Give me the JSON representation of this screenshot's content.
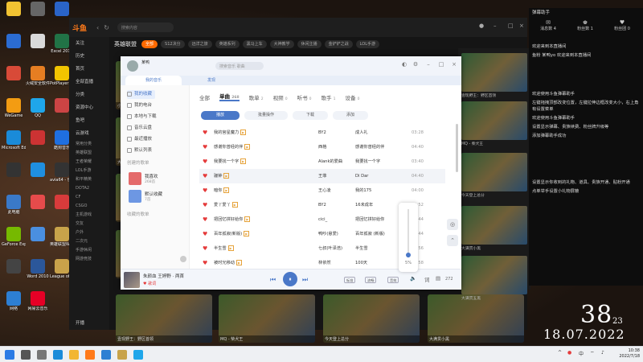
{
  "desktop": {
    "icons": [
      {
        "label": "",
        "color": "#f1c232"
      },
      {
        "label": "",
        "color": "#2b6cd2"
      },
      {
        "label": "",
        "color": "#d84a38"
      },
      {
        "label": "WeGame",
        "color": "#f39c12"
      },
      {
        "label": "Microsoft Edge",
        "color": "#1a8bd9"
      },
      {
        "label": "",
        "color": "#333333"
      },
      {
        "label": "此电脑",
        "color": "#3a79c8"
      },
      {
        "label": "GeForce Experience",
        "color": "#76b900"
      },
      {
        "label": "",
        "color": "#444444"
      },
      {
        "label": "网络",
        "color": "#2d7fd3"
      },
      {
        "label": "",
        "color": "#666666"
      },
      {
        "label": "",
        "color": "#d9d9d9"
      },
      {
        "label": "火绒安全软件",
        "color": "#e67e22"
      },
      {
        "label": "QQ",
        "color": "#1fa6ea"
      },
      {
        "label": "",
        "color": "#cc3333"
      },
      {
        "label": "",
        "color": "#1f8fe0"
      },
      {
        "label": "",
        "color": "#e64b4b"
      },
      {
        "label": "",
        "color": "#4a8fe0"
      },
      {
        "label": "Word 2010",
        "color": "#2b579a"
      },
      {
        "label": "网易云音乐",
        "color": "#e60026"
      },
      {
        "label": "",
        "color": "#2a64c8"
      },
      {
        "label": "Excel 2010",
        "color": "#217346"
      },
      {
        "label": "PotPlayer 64 bit",
        "color": "#f2c400"
      },
      {
        "label": "",
        "color": "#cc4444"
      },
      {
        "label": "酷狗音乐",
        "color": "#1f6fe0"
      },
      {
        "label": "avia64 - 快捷方式",
        "color": "#333333"
      },
      {
        "label": "",
        "color": "#d83b3b"
      },
      {
        "label": "英雄联盟WeGame版",
        "color": "#c8a34a"
      },
      {
        "label": "League of Legends",
        "color": "#c9a24a"
      }
    ]
  },
  "douyu": {
    "logo": "斗鱼",
    "search_placeholder": "搜索内容",
    "section_title": "英雄联盟",
    "categories": [
      "全部",
      "S12决分",
      "远洋之旅",
      "英雄系列",
      "黑马上车",
      "大神教学",
      "休闲主播",
      "金铲铲之战",
      "LOL手游"
    ],
    "sidebar": [
      "关注",
      "历史",
      "首页",
      "全部直播",
      "分类",
      "资源中心",
      "鱼吧",
      "云游戏",
      "常用分类",
      "英雄联盟",
      "王者荣耀",
      "LOL手游",
      "和平精英",
      "DOTA2",
      "CF",
      "CSGO",
      "主机游戏",
      "交友",
      "户外",
      "二次元",
      "手游休闲",
      "网游竞技"
    ],
    "bottom_label": "开播",
    "thumbs": [
      {
        "caption": "壹现野王：野区首领"
      },
      {
        "caption": "MQ - 柴犬王"
      },
      {
        "caption": "今天登上总分"
      },
      {
        "caption": "大满贯小黑"
      },
      {
        "caption": "小猫咪冲"
      },
      {
        "caption": "大满贯五黑"
      },
      {
        "caption": ""
      },
      {
        "caption": ""
      },
      {
        "caption": ""
      },
      {
        "caption": ""
      }
    ]
  },
  "player": {
    "user": "某鸭",
    "search_placeholder": "搜索音乐 歌曲",
    "tabs": [
      "我的音乐",
      "发现"
    ],
    "sidebar": {
      "items": [
        "我的收藏",
        "我的电台",
        "本地与下载",
        "音乐云盘",
        "最近播放",
        "默认列表"
      ],
      "created_header": "创建的歌单",
      "playlists": [
        {
          "title": "我喜欢",
          "count": "268首",
          "color": "#e46a6a"
        },
        {
          "title": "默认收藏",
          "count": "7首",
          "color": "#6d97e3"
        }
      ],
      "collected_header": "收藏的歌单"
    },
    "filter_tabs": [
      {
        "label": "全部",
        "count": ""
      },
      {
        "label": "单曲",
        "count": "268"
      },
      {
        "label": "歌单",
        "count": "2"
      },
      {
        "label": "视频",
        "count": "0"
      },
      {
        "label": "听书",
        "count": "0"
      },
      {
        "label": "歌手",
        "count": "1"
      },
      {
        "label": "设备",
        "count": "0"
      }
    ],
    "actions": [
      "播放",
      "批量操作",
      "下载",
      "添加"
    ],
    "songs": [
      {
        "title": "我的宫星魔力",
        "artist": "BY2",
        "album": "成人礼",
        "duration": "03:28"
      },
      {
        "title": "感谢你曾经的伴",
        "artist": "西格",
        "album": "感谢你曾经的伴",
        "duration": "04:40"
      },
      {
        "title": "我要找一个字",
        "artist": "Alank的爱曲",
        "album": "我要找一个字",
        "duration": "03:40"
      },
      {
        "title": "骊钟",
        "artist": "王菲",
        "album": "Di Dar",
        "duration": "04:40"
      },
      {
        "title": "暗你",
        "artist": "王心凌",
        "album": "我的175",
        "duration": "04:00"
      },
      {
        "title": "爱丫爱丫",
        "artist": "BY2",
        "album": "16未成年",
        "duration": "03:52"
      },
      {
        "title": "把回忆拼好给你",
        "artist": "cici_",
        "album": "把回忆拼好给你",
        "duration": "04:44"
      },
      {
        "title": "百年孤寂(新版)",
        "artist": "鸭吵(悬爱)",
        "album": "百年孤寂 (新版)",
        "duration": "04:44"
      },
      {
        "title": "半生雪",
        "artist": "七叔(叶泽浩)",
        "album": "半生雪",
        "duration": "02:56"
      },
      {
        "title": "被时光移动",
        "artist": "林依然",
        "album": "100天",
        "duration": "03:58"
      }
    ],
    "now_playing": {
      "title": "朱颜血 王婷野 · 两首",
      "sub": "♥ 歌词"
    },
    "controls": [
      "⏮",
      "⏸",
      "⏭"
    ],
    "chips": [
      "标准",
      "流畅",
      "音效"
    ],
    "volume_label": "5%",
    "volume_level": 0.05,
    "comment_count": "272"
  },
  "chat": {
    "title": "弹幕助手",
    "tabs": [
      "消息数",
      "粉丝数",
      "粉丝团"
    ],
    "tab_counts": [
      "4",
      "1",
      "0"
    ],
    "messages": [
      "欢迎来到本直播间",
      "鱼粉 某鸭yo 欢迎来到本直播间",
      "欢迎使用斗鱼弹幕助手",
      "左键拖拽顶部改变位置，左键拉伸边框改变大小，右上角有设置菜单",
      "欢迎使用斗鱼弹幕助手",
      "设置显示弹幕、贵族续费、粉丝牌升级等",
      "添加弹幕助手成功",
      "设置显示你收到的礼物、道具、贵族开通、贴粉开通",
      "点单举手设置小礼物屏蔽"
    ]
  },
  "overlay_clock": {
    "time": "38",
    "seconds": "23",
    "date": "18.07.2022"
  },
  "taskbar": {
    "time": "10:38",
    "date": "2022/7/18",
    "tray": [
      "^",
      "中"
    ]
  }
}
